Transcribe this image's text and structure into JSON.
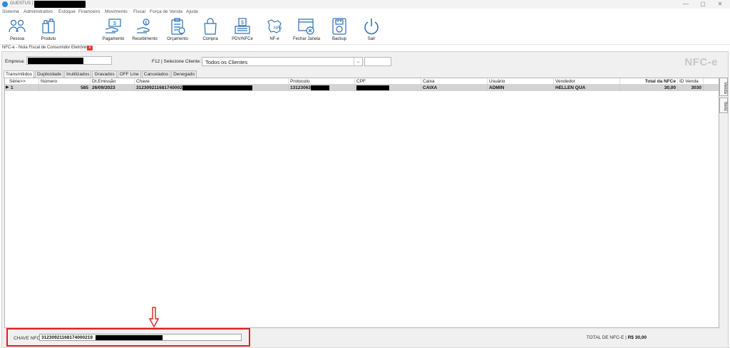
{
  "window": {
    "title": "GUESTUS |",
    "controls": {
      "minimize": "—",
      "maximize": "▢",
      "close": "✕"
    }
  },
  "menu": [
    "Sistema",
    "Administrativo",
    "Estoque",
    "Financeiro",
    "Movimento",
    "Fiscal",
    "Força de Venda",
    "Ajuda"
  ],
  "toolbar": [
    {
      "label": "Pessoa",
      "icon": "people-icon"
    },
    {
      "label": "Produto",
      "icon": "product-icon"
    },
    {
      "label": "Pagamento",
      "icon": "payment-icon"
    },
    {
      "label": "Recebimento",
      "icon": "receipt-hand-icon"
    },
    {
      "label": "Orçamento",
      "icon": "budget-clipboard-icon"
    },
    {
      "label": "Compra",
      "icon": "shopping-bag-icon"
    },
    {
      "label": "PDV/NFCe",
      "icon": "pos-terminal-icon"
    },
    {
      "label": "NF-e",
      "icon": "nfe-map-icon"
    },
    {
      "label": "Fechar Janela",
      "icon": "close-window-icon"
    },
    {
      "label": "Backup",
      "icon": "backup-icon"
    },
    {
      "label": "Sair",
      "icon": "power-icon"
    }
  ],
  "document_tab": {
    "label": "NFC-e - Nota Fiscal de Consumidor Eletrônica",
    "close": "x"
  },
  "filters": {
    "empresa_label": "Empresa:",
    "cliente_label": "F12 | Selecione Cliente:",
    "cliente_value": "Todos os Clientes",
    "brand": "NFC-e"
  },
  "tabs": [
    "Transmitidos",
    "Duplicidade",
    "Inutilizados",
    "Gravados",
    "OFF Line",
    "Cancelados",
    "Denegado"
  ],
  "grid": {
    "columns": [
      "Série>>",
      "Número",
      "Dt.Emissão",
      "Chave",
      "Protocolo",
      "CPF",
      "Caixa",
      "Usuário",
      "Vendedor",
      "Total da NFCe",
      "ID Venda"
    ],
    "rows": [
      {
        "indicator": "▶",
        "serie": "1",
        "numero": "585",
        "emissao": "26/09/2023",
        "chave": "312309211681740002",
        "protocolo": "13123063",
        "cpf": "",
        "caixa": "CAIXA",
        "usuario": "ADMIN",
        "vendedor": "HELLEN QUA",
        "total": "30,00",
        "id_venda": "3030"
      }
    ]
  },
  "side_tabs": [
    "Venda",
    "Itens"
  ],
  "footer": {
    "chave_label": "CHAVE NFC-e:",
    "chave_value": "31230921168174000219",
    "total_label": "TOTAL DE NFC-E |",
    "total_value": "R$ 30,00"
  },
  "colors": {
    "highlight_border": "#e02020",
    "arrow": "#e02020",
    "selected_row": "#d4d4d4",
    "icon_stroke": "#2a6fb3"
  }
}
